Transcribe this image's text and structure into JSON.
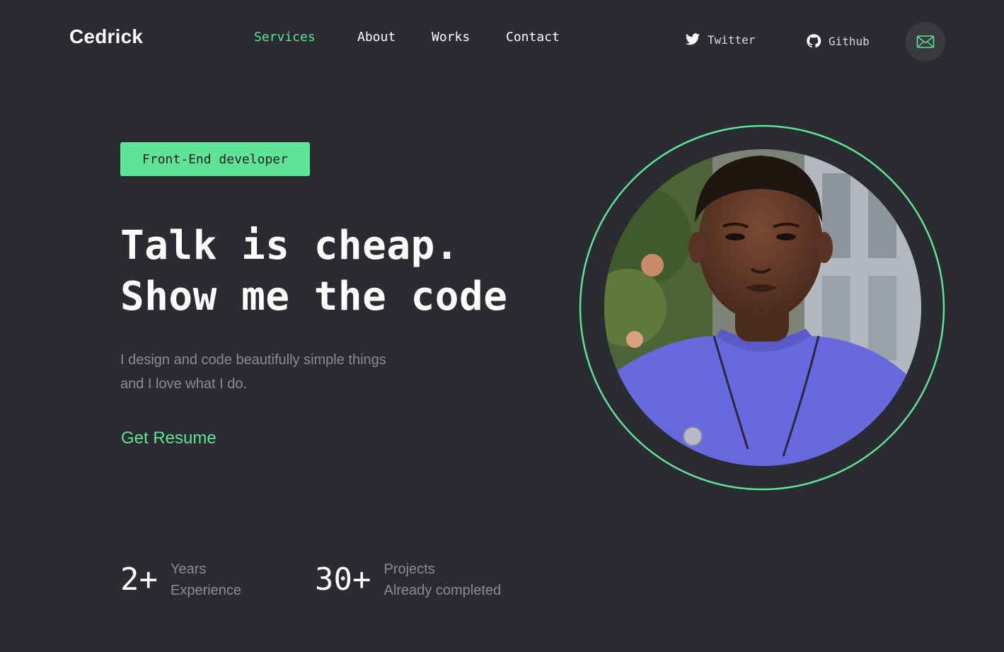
{
  "header": {
    "logo": "Cedrick",
    "nav": [
      {
        "label": "Services",
        "active": true
      },
      {
        "label": "About",
        "active": false
      },
      {
        "label": "Works",
        "active": false
      },
      {
        "label": "Contact",
        "active": false
      }
    ],
    "social": {
      "twitter": {
        "label": "Twitter",
        "icon": "twitter-icon"
      },
      "github": {
        "label": "Github",
        "icon": "github-icon"
      }
    },
    "mail_icon": "mail-icon"
  },
  "hero": {
    "badge": "Front-End developer",
    "headline": [
      "Talk is cheap.",
      "Show me the code"
    ],
    "description": [
      "I design and code beautifully simple things",
      "and I love what I do."
    ],
    "cta": "Get Resume"
  },
  "stats": [
    {
      "value": "2+",
      "label": [
        "Years",
        "Experience"
      ]
    },
    {
      "value": "30+",
      "label": [
        "Projects",
        "Already completed"
      ]
    }
  ],
  "colors": {
    "background": "#2b2c31",
    "accent": "#5ee495",
    "text": "#ffffff",
    "muted": "#8a8b90"
  }
}
